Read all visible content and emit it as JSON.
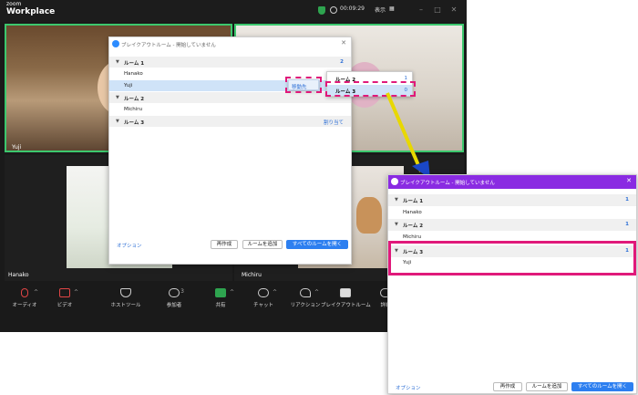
{
  "zoom": {
    "brand_top": "zoom",
    "brand_name": "Workplace",
    "timer": "00:09:29",
    "view_label": "表示",
    "view_icon": "grid-icon",
    "participants": [
      "Yuji",
      "Hanako",
      "Michiru"
    ],
    "toolbar": [
      {
        "label": "オーディオ",
        "icon": "microphone-muted-icon"
      },
      {
        "label": "ビデオ",
        "icon": "video-off-icon"
      },
      {
        "label": "ホストツール",
        "icon": "shield-icon"
      },
      {
        "label": "参加者",
        "icon": "participants-icon",
        "count": "3"
      },
      {
        "label": "共有",
        "icon": "share-icon"
      },
      {
        "label": "チャット",
        "icon": "chat-icon"
      },
      {
        "label": "リアクション",
        "icon": "heart-icon"
      },
      {
        "label": "ブレイクアウトルーム",
        "icon": "breakout-rooms-icon"
      },
      {
        "label": "詳細",
        "icon": "more-icon"
      }
    ]
  },
  "dialog1": {
    "title": "ブレイクアウトルーム - 開始していません",
    "rooms": [
      {
        "name": "ルーム 1",
        "count": "2",
        "members": [
          "Hanako",
          "Yuji"
        ]
      },
      {
        "name": "ルーム 2",
        "count": "",
        "members": [
          "Michiru"
        ]
      },
      {
        "name": "ルーム 3",
        "count": "",
        "members": []
      }
    ],
    "move_to": "移動先",
    "assign": "割り当て",
    "popup_items": [
      {
        "name": "ルーム 2",
        "count": "1"
      },
      {
        "name": "ルーム 3",
        "count": "0"
      }
    ],
    "options": "オプション",
    "recreate": "再作成",
    "add_room": "ルームを追加",
    "open_all": "すべてのルームを開く"
  },
  "dialog2": {
    "title": "ブレイクアウトルーム - 開始していません",
    "rooms": [
      {
        "name": "ルーム 1",
        "count": "1",
        "members": [
          "Hanako"
        ]
      },
      {
        "name": "ルーム 2",
        "count": "1",
        "members": [
          "Michiru"
        ]
      },
      {
        "name": "ルーム 3",
        "count": "1",
        "members": [
          "Yuji"
        ]
      }
    ],
    "options": "オプション",
    "recreate": "再作成",
    "add_room": "ルームを追加",
    "open_all": "すべてのルームを開く"
  },
  "colors": {
    "highlight": "#e0197a",
    "arrow": "#e8d800",
    "accent": "#2d7ff0",
    "dialog2_titlebar": "#8a2be2"
  }
}
